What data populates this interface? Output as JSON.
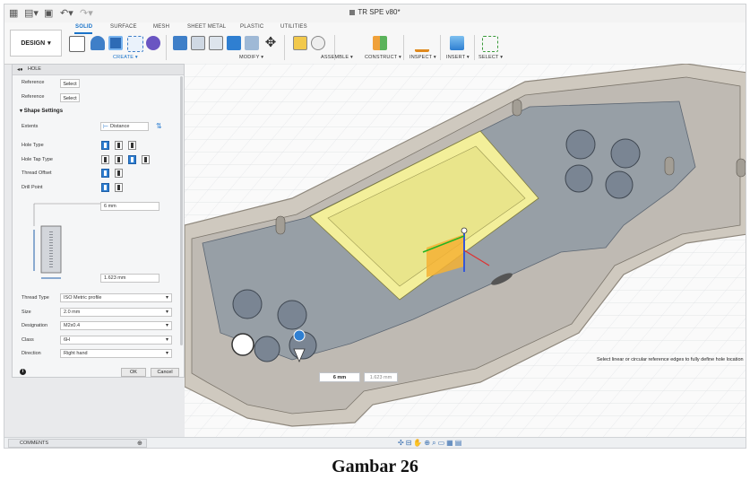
{
  "app": {
    "document_title": "TR SPE v80*",
    "workspace_label": "DESIGN"
  },
  "ribbon": {
    "tabs": [
      "SOLID",
      "SURFACE",
      "MESH",
      "SHEET METAL",
      "PLASTIC",
      "UTILITIES"
    ],
    "active_tab": "SOLID",
    "groups": [
      "CREATE ▾",
      "MODIFY ▾",
      "ASSEMBLE ▾",
      "CONSTRUCT ▾",
      "INSPECT ▾",
      "INSERT ▾",
      "SELECT ▾"
    ]
  },
  "panel": {
    "title": "HOLE",
    "reference_1": {
      "label": "Reference",
      "button": "Select"
    },
    "reference_2": {
      "label": "Reference",
      "button": "Select"
    },
    "shape_settings": "Shape Settings",
    "extents": {
      "label": "Extents",
      "value": "Distance"
    },
    "hole_type": "Hole Type",
    "hole_tap_type": "Hole Tap Type",
    "thread_offset": "Thread Offset",
    "drill_point": "Drill Point",
    "diameter": "6 mm",
    "depth": "1.623 mm",
    "thread_type": {
      "label": "Thread Type",
      "value": "ISO Metric profile"
    },
    "size": {
      "label": "Size",
      "value": "2.0 mm"
    },
    "designation": {
      "label": "Designation",
      "value": "M2x0.4"
    },
    "class": {
      "label": "Class",
      "value": "6H"
    },
    "direction": {
      "label": "Direction",
      "value": "Right hand"
    },
    "ok": "OK",
    "cancel": "Cancel"
  },
  "viewport": {
    "status_message": "Select linear or circular reference edges to fully define hole location",
    "dim_distance": "6 mm",
    "dim_depth": "1.623 mm"
  },
  "bottom": {
    "comments": "COMMENTS"
  },
  "caption": "Gambar 26"
}
